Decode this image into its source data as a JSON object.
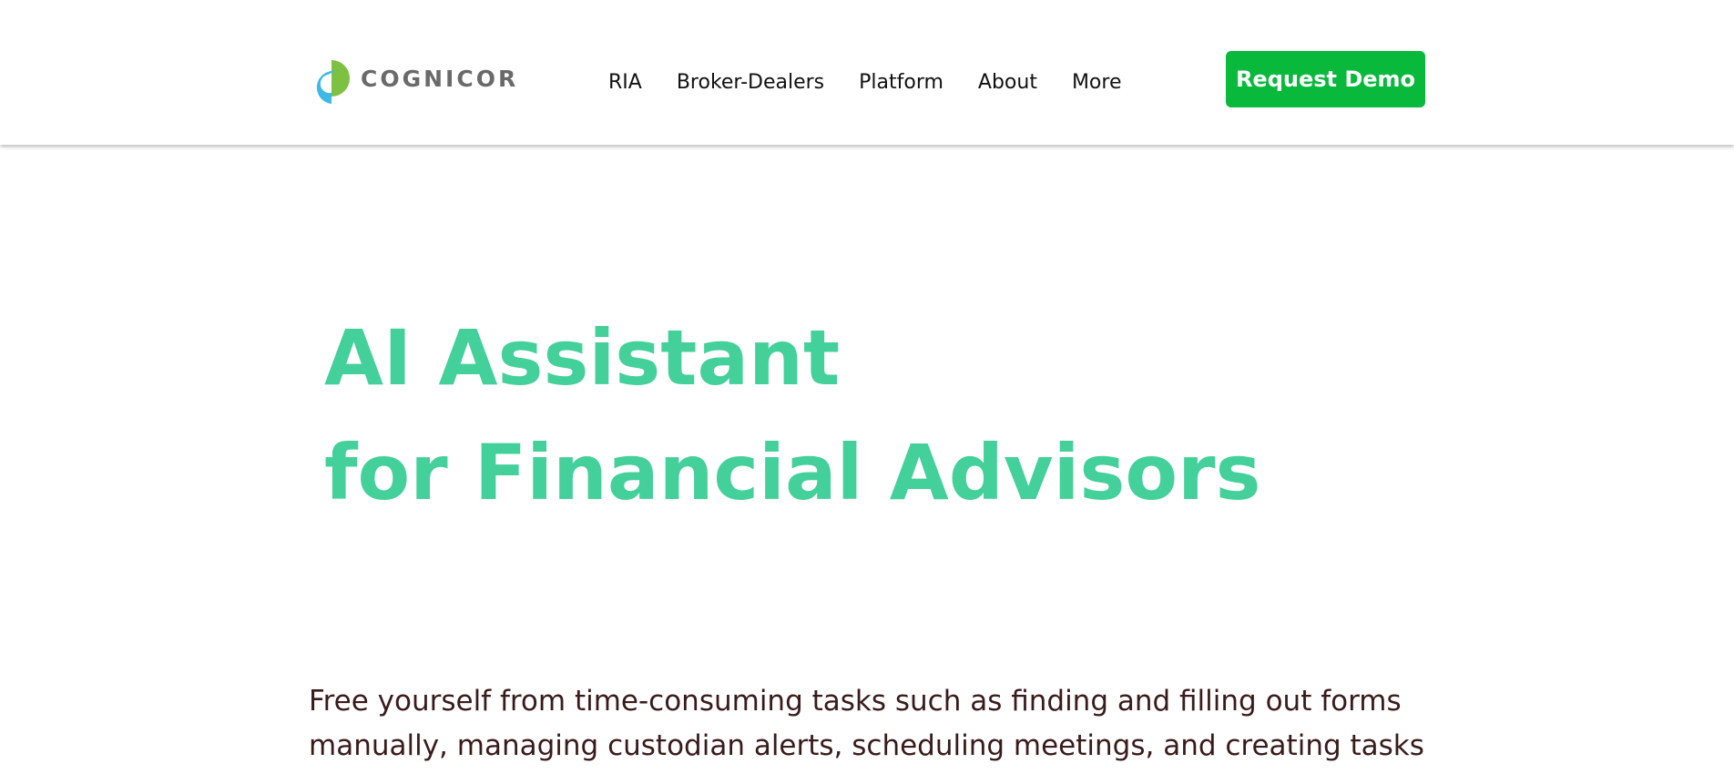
{
  "header": {
    "logo_text": "COGNICOR",
    "nav": [
      {
        "label": "RIA"
      },
      {
        "label": "Broker-Dealers"
      },
      {
        "label": "Platform"
      },
      {
        "label": "About"
      },
      {
        "label": "More"
      }
    ],
    "cta_label": "Request Demo"
  },
  "hero": {
    "title_line1": "AI Assistant",
    "title_line2": "for Financial Advisors",
    "description": "Free yourself from time-consuming tasks such as finding and filling out forms manually, managing custodian alerts, scheduling meetings, and creating tasks"
  },
  "colors": {
    "accent_green": "#44d09a",
    "button_green": "#08b93c",
    "logo_blue": "#3cb9e6",
    "logo_green": "#7cc142"
  }
}
